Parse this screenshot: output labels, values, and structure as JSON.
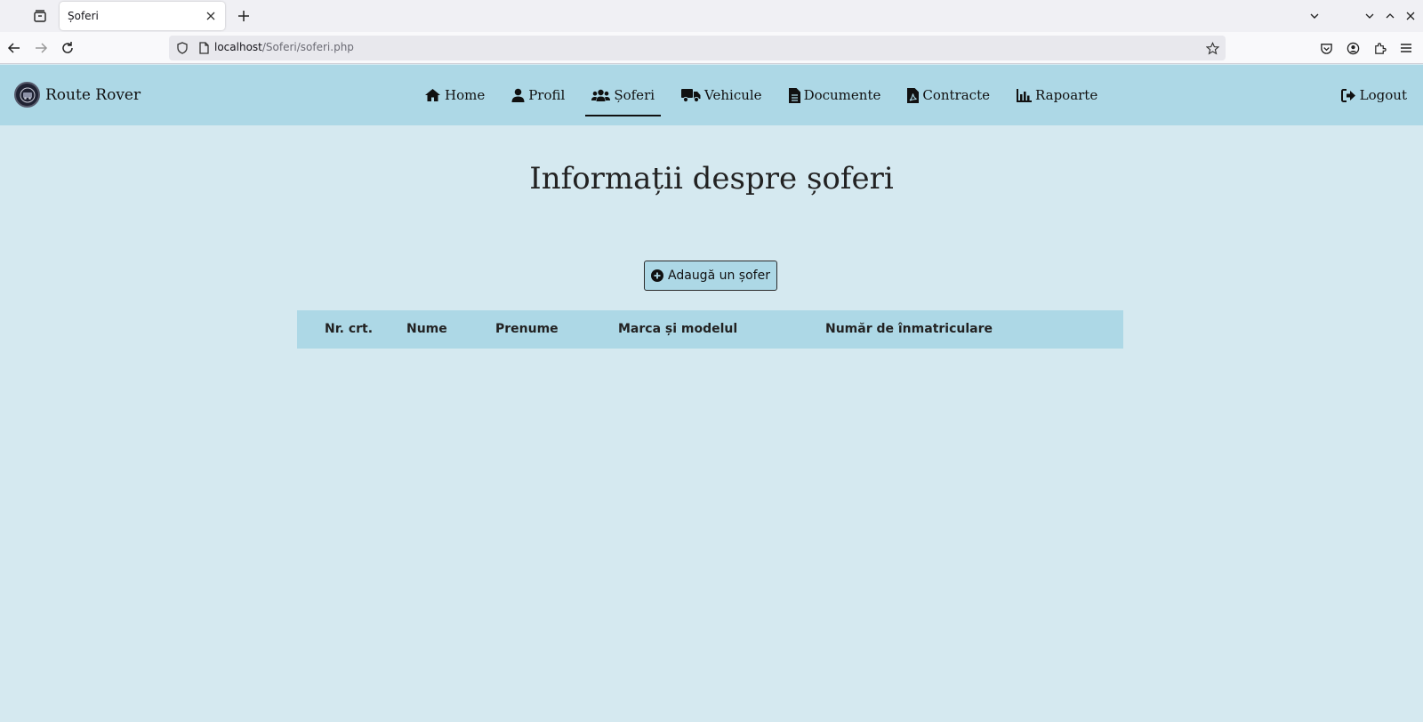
{
  "browser": {
    "tab_title": "Șoferi",
    "url_host": "localhost",
    "url_path": "/Soferi/soferi.php"
  },
  "site": {
    "brand": "Route Rover",
    "nav": [
      {
        "label": "Home",
        "icon": "home-icon"
      },
      {
        "label": "Profil",
        "icon": "user-icon"
      },
      {
        "label": "Șoferi",
        "icon": "users-icon",
        "active": true
      },
      {
        "label": "Vehicule",
        "icon": "truck-icon"
      },
      {
        "label": "Documente",
        "icon": "document-icon"
      },
      {
        "label": "Contracte",
        "icon": "pdf-file-icon"
      },
      {
        "label": "Rapoarte",
        "icon": "bar-chart-icon"
      }
    ],
    "logout": "Logout"
  },
  "main": {
    "title": "Informații despre șoferi",
    "add_button": "Adaugă un șofer",
    "table": {
      "headers": [
        "Nr. crt.",
        "Nume",
        "Prenume",
        "Marca și modelul",
        "Număr de înmatriculare"
      ],
      "rows": []
    }
  },
  "colors": {
    "header_bg": "#add8e6",
    "page_bg": "#d5e9f0"
  }
}
